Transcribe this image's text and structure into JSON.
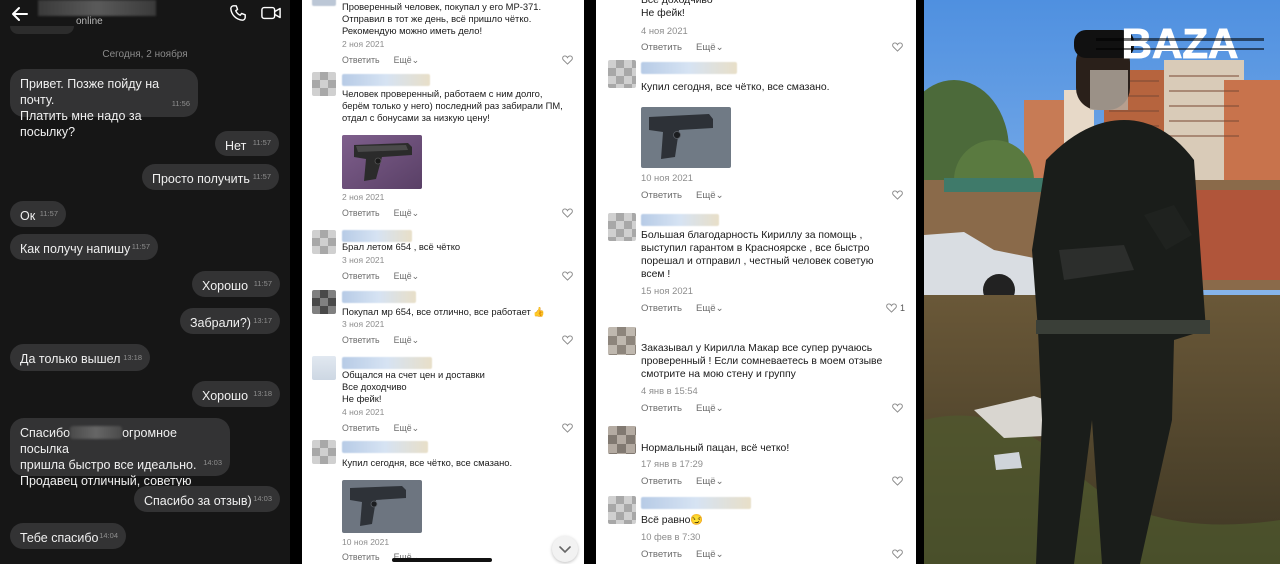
{
  "chat": {
    "status": "online",
    "date_separator": "Сегодня, 2 ноября",
    "messages": [
      {
        "side": "in",
        "text": "Привет. Позже пойду на почту.\nПлатить мне надо за посылку?",
        "time": "11:56"
      },
      {
        "side": "out",
        "text": "Нет",
        "time": "11:57"
      },
      {
        "side": "out",
        "text": "Просто получить",
        "time": "11:57"
      },
      {
        "side": "in",
        "text": "Ок",
        "time": "11:57"
      },
      {
        "side": "in",
        "text": "Как получу напишу",
        "time": "11:57"
      },
      {
        "side": "out",
        "text": "Хорошо",
        "time": "11:57"
      },
      {
        "side": "out",
        "text": "Забрали?)",
        "time": "13:17"
      },
      {
        "side": "in",
        "text": "Да только вышел",
        "time": "13:18"
      },
      {
        "side": "out",
        "text": "Хорошо",
        "time": "13:18"
      },
      {
        "side": "in",
        "text_before": "Спасибо",
        "text_after": "огромное посылка\nпришла быстро все идеально.\nПродавец отличный, советую",
        "time": "14:03"
      },
      {
        "side": "out",
        "text": "Спасибо за отзыв)",
        "time": "14:03"
      },
      {
        "side": "in",
        "text": "Тебе спасибо",
        "time": "14:04"
      }
    ]
  },
  "actions": {
    "reply": "Ответить",
    "more": "Ещё"
  },
  "panel2": {
    "comments": [
      {
        "text": "Проверенный человек, покупал у его МР-371.\nОтправил в тот же день, всё пришло чётко.\nРекомендую можно иметь дело!",
        "date": "2 ноя 2021"
      },
      {
        "text": "Человек проверенный, работаем с ним долго,\nберём только у него) последний раз забирали ПМ,\nотдал с бонусами за низкую цену!",
        "date": "2 ноя 2021"
      },
      {
        "text": "Брал летом 654 , всё чётко",
        "date": "3 ноя 2021"
      },
      {
        "text": "Покупал мр 654, все отлично, все работает 👍",
        "date": "3 ноя 2021"
      },
      {
        "text": "Общался на счет цен и доставки\nВсе доходчиво\nНе фейк!",
        "date": "4 ноя 2021"
      },
      {
        "text": "Купил сегодня, все чётко, все смазано.",
        "date": "10 ноя 2021"
      }
    ]
  },
  "panel3": {
    "comments": [
      {
        "text": "Все доходчиво\nНе фейк!",
        "date": "4 ноя 2021"
      },
      {
        "text": "Купил сегодня, все чётко, все смазано.",
        "date": "10 ноя 2021"
      },
      {
        "text": "Большая благодарность Кириллу за помощь ,\nвыступил гарантом в Красноярске , все быстро\nпорешал и отправил , честный человек советую\nвсем !",
        "date": "15 ноя 2021",
        "likes": "1"
      },
      {
        "text": "Заказывал у Кирилла Макар все супер ручаюсь\nпроверенный ! Если сомневаетесь в моем отзыве\nсмотрите на мою стену и группу",
        "date": "4 янв в 15:54"
      },
      {
        "text": "Нормальный пацан, всё четко!",
        "date": "17 янв в 17:29"
      },
      {
        "text": "Всё равно😏",
        "date": "10 фев в 7:30"
      }
    ]
  },
  "photo": {
    "logo": "BAZA"
  },
  "colors": {
    "chat_bg": "#161616",
    "bubble": "#333334",
    "link_gray": "#6d6d6d"
  }
}
